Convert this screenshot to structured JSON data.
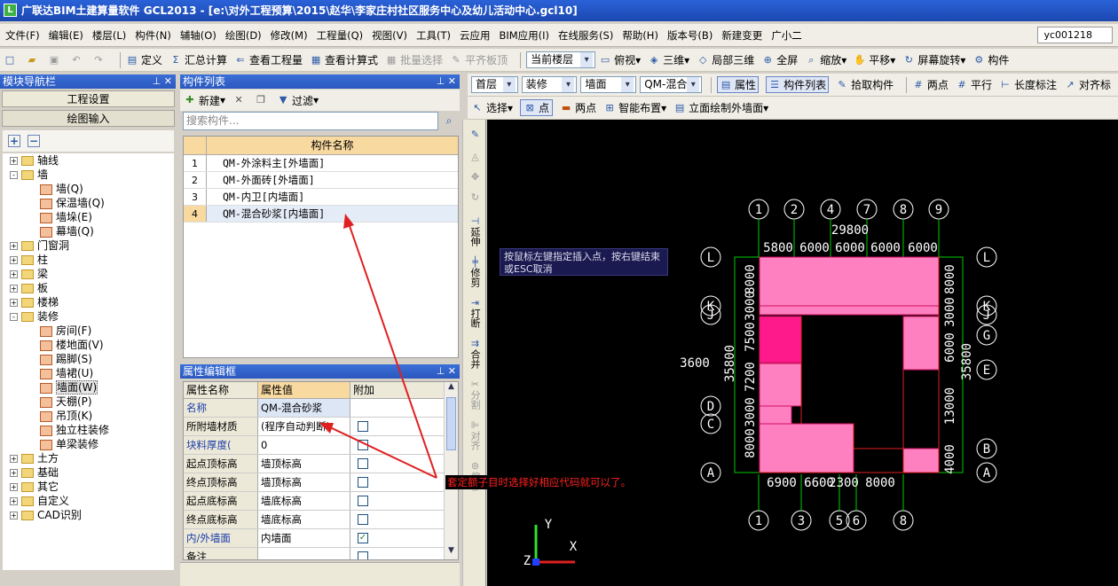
{
  "title": "广联达BIM土建算量软件 GCL2013 - [e:\\对外工程预算\\2015\\赵华\\李家庄村社区服务中心及幼儿活动中心.gcl10]",
  "menu": [
    "文件(F)",
    "编辑(E)",
    "楼层(L)",
    "构件(N)",
    "辅轴(O)",
    "绘图(D)",
    "修改(M)",
    "工程量(Q)",
    "视图(V)",
    "工具(T)",
    "云应用",
    "BIM应用(I)",
    "在线服务(S)",
    "帮助(H)",
    "版本号(B)",
    "新建变更",
    "广小二"
  ],
  "user": "yc001218",
  "toolbar1": [
    "定义",
    "汇总计算",
    "查看工程量",
    "查看计算式",
    "批量选择",
    "平齐板顶",
    "当前楼层",
    "俯视",
    "三维",
    "局部三维",
    "全屏",
    "缩放",
    "平移",
    "屏幕旋转",
    "构件"
  ],
  "toolbar2": {
    "floor": "首层",
    "cat": "装修",
    "sub": "墙面",
    "comp": "QM-混合砂",
    "attr": "属性",
    "list": "构件列表",
    "pick": "拾取构件",
    "twopt": "两点",
    "parallel": "平行",
    "dim": "长度标注",
    "align": "对齐标"
  },
  "toolbar3": {
    "select": "选择",
    "point": "点",
    "twopt": "两点",
    "smart": "智能布置",
    "elev": "立面绘制外墙面"
  },
  "nav": {
    "title": "模块导航栏",
    "settings": "工程设置",
    "drawing": "绘图输入"
  },
  "tree": [
    {
      "label": "轴线",
      "lvl": 0,
      "pm": "+"
    },
    {
      "label": "墙",
      "lvl": 0,
      "pm": "-"
    },
    {
      "label": "墙(Q)",
      "lvl": 1
    },
    {
      "label": "保温墙(Q)",
      "lvl": 1
    },
    {
      "label": "墙垛(E)",
      "lvl": 1
    },
    {
      "label": "幕墙(Q)",
      "lvl": 1
    },
    {
      "label": "门窗洞",
      "lvl": 0,
      "pm": "+"
    },
    {
      "label": "柱",
      "lvl": 0,
      "pm": "+"
    },
    {
      "label": "梁",
      "lvl": 0,
      "pm": "+"
    },
    {
      "label": "板",
      "lvl": 0,
      "pm": "+"
    },
    {
      "label": "楼梯",
      "lvl": 0,
      "pm": "+"
    },
    {
      "label": "装修",
      "lvl": 0,
      "pm": "-"
    },
    {
      "label": "房间(F)",
      "lvl": 1
    },
    {
      "label": "楼地面(V)",
      "lvl": 1
    },
    {
      "label": "踢脚(S)",
      "lvl": 1
    },
    {
      "label": "墙裙(U)",
      "lvl": 1
    },
    {
      "label": "墙面(W)",
      "lvl": 1,
      "sel": true
    },
    {
      "label": "天棚(P)",
      "lvl": 1
    },
    {
      "label": "吊顶(K)",
      "lvl": 1
    },
    {
      "label": "独立柱装修",
      "lvl": 1
    },
    {
      "label": "单梁装修",
      "lvl": 1
    },
    {
      "label": "土方",
      "lvl": 0,
      "pm": "+"
    },
    {
      "label": "基础",
      "lvl": 0,
      "pm": "+"
    },
    {
      "label": "其它",
      "lvl": 0,
      "pm": "+"
    },
    {
      "label": "自定义",
      "lvl": 0,
      "pm": "+"
    },
    {
      "label": "CAD识别",
      "lvl": 0,
      "pm": "+"
    }
  ],
  "complist": {
    "title": "构件列表",
    "new": "新建",
    "filter": "过滤",
    "search": "搜索构件...",
    "header": "构件名称",
    "rows": [
      {
        "n": "1",
        "name": "QM-外涂料主[外墙面]"
      },
      {
        "n": "2",
        "name": "QM-外面砖[外墙面]"
      },
      {
        "n": "3",
        "name": "QM-内卫[内墙面]"
      },
      {
        "n": "4",
        "name": "QM-混合砂浆[内墙面]"
      }
    ]
  },
  "props": {
    "title": "属性编辑框",
    "h1": "属性名称",
    "h2": "属性值",
    "h3": "附加",
    "rows": [
      {
        "k": "名称",
        "v": "QM-混合砂浆",
        "blue": true,
        "cb": null
      },
      {
        "k": "所附墙材质",
        "v": "(程序自动判断)",
        "cb": false
      },
      {
        "k": "块料厚度(",
        "v": "0",
        "blue": true,
        "cb": false
      },
      {
        "k": "起点顶标高",
        "v": "墙顶标高",
        "cb": false
      },
      {
        "k": "终点顶标高",
        "v": "墙顶标高",
        "cb": false
      },
      {
        "k": "起点底标高",
        "v": "墙底标高",
        "cb": false
      },
      {
        "k": "终点底标高",
        "v": "墙底标高",
        "cb": false
      },
      {
        "k": "内/外墙面",
        "v": "内墙面",
        "blue": true,
        "cb": true
      },
      {
        "k": "备注",
        "v": "",
        "cb": false
      }
    ]
  },
  "hint": "按鼠标左键指定插入点，按右键结束或ESC取消",
  "annotation": "套定额子目时选择好相应代码就可以了。",
  "vtools": [
    "延伸",
    "修剪",
    "打断",
    "合并",
    "分割",
    "对齐",
    "偏移"
  ],
  "cad": {
    "top_axes": [
      "1",
      "2",
      "4",
      "7",
      "8",
      "9"
    ],
    "bottom_axes": [
      "1",
      "3",
      "5",
      "6",
      "8"
    ],
    "left_axes": [
      "L",
      "K",
      "J",
      "F",
      "E",
      "D",
      "C",
      "A"
    ],
    "right_axes": [
      "L",
      "K",
      "J",
      "G",
      "E",
      "B",
      "A"
    ],
    "top_total": "29800",
    "top_dims": [
      "5800",
      "6000",
      "6000",
      "6000",
      "6000"
    ],
    "bottom_dims": [
      "6900",
      "6600",
      "2300",
      "8000"
    ],
    "left_dims": [
      "3600",
      "35800",
      "8000",
      "3000",
      "7200",
      "7500",
      "3000",
      "8000"
    ],
    "right_dims": [
      "35800",
      "8000",
      "3000",
      "6000",
      "13000",
      "4000"
    ],
    "colors": {
      "pink": "#ff80c0",
      "magenta": "#ff1a8c",
      "line": "#ffffff",
      "axis": "#00cc00"
    }
  }
}
